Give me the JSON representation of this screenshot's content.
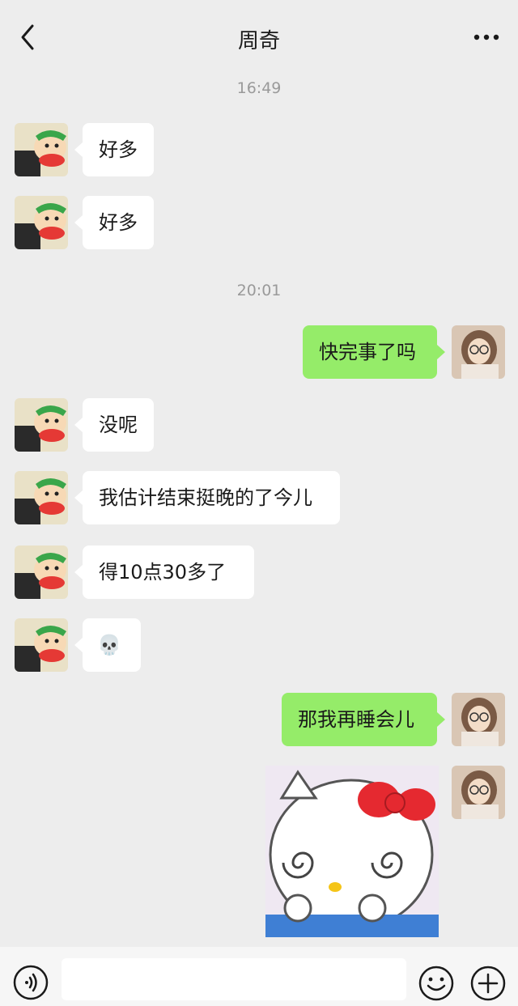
{
  "header": {
    "title": "周奇",
    "back_icon": "chevron-left-icon",
    "more_icon": "ellipsis-icon"
  },
  "timestamps": [
    "16:49",
    "20:01"
  ],
  "messages": [
    {
      "side": "in",
      "text": "好多"
    },
    {
      "side": "in",
      "text": "好多"
    },
    {
      "side": "out",
      "text": "快完事了吗"
    },
    {
      "side": "in",
      "text": "没呢"
    },
    {
      "side": "in",
      "text": "我估计结束挺晚的了今儿"
    },
    {
      "side": "in",
      "text": "得10点30多了"
    },
    {
      "side": "in",
      "text": "💀"
    },
    {
      "side": "out",
      "text": "那我再睡会儿"
    },
    {
      "side": "out",
      "type": "sticker",
      "sticker": "hello-kitty-dizzy-sticker"
    }
  ],
  "input": {
    "placeholder": "",
    "value": ""
  },
  "toolbar": {
    "voice_icon": "voice-icon",
    "emoji_icon": "emoji-icon",
    "plus_icon": "plus-icon"
  },
  "colors": {
    "background": "#ededed",
    "incoming_bubble": "#ffffff",
    "outgoing_bubble": "#95ec69",
    "timestamp": "#9a9a9a"
  }
}
